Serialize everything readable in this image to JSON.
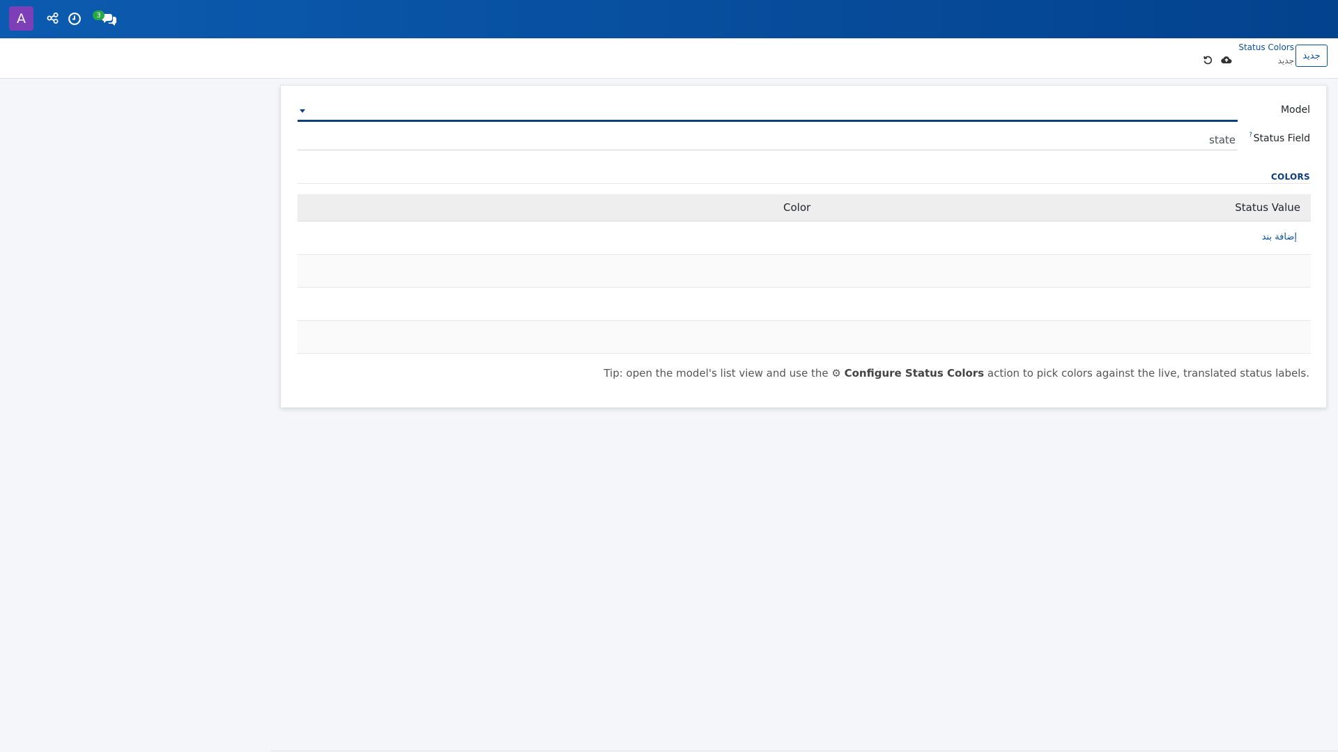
{
  "navbar": {
    "avatar_letter": "A",
    "messages_badge": "3",
    "icons": [
      "share-nodes-icon",
      "clock-icon",
      "chat-icon"
    ]
  },
  "control_panel": {
    "new_button": "جديد",
    "breadcrumb_title": "Status Colors",
    "breadcrumb_sub": "جديد",
    "icons": [
      "cloud-upload-icon",
      "undo-icon"
    ]
  },
  "form": {
    "model_label": "Model",
    "model_value": "",
    "status_field_label": "Status Field",
    "status_field_help": "?",
    "status_field_value": "state",
    "section_title": "COLORS",
    "table": {
      "columns": [
        "Status Value",
        "Color"
      ],
      "add_line": "إضافة بند"
    },
    "tip_prefix": "Tip: open the model's list view and use the ",
    "tip_gear": "⚙",
    "tip_action": "Configure Status Colors",
    "tip_suffix": " action to pick colors against the live, translated status labels."
  },
  "colors": {
    "navbar_start": "#0c5bb0",
    "navbar_end": "#03428d",
    "avatar": "#7c3fb8",
    "badge": "#28a745",
    "accent": "#0b4f9c"
  }
}
